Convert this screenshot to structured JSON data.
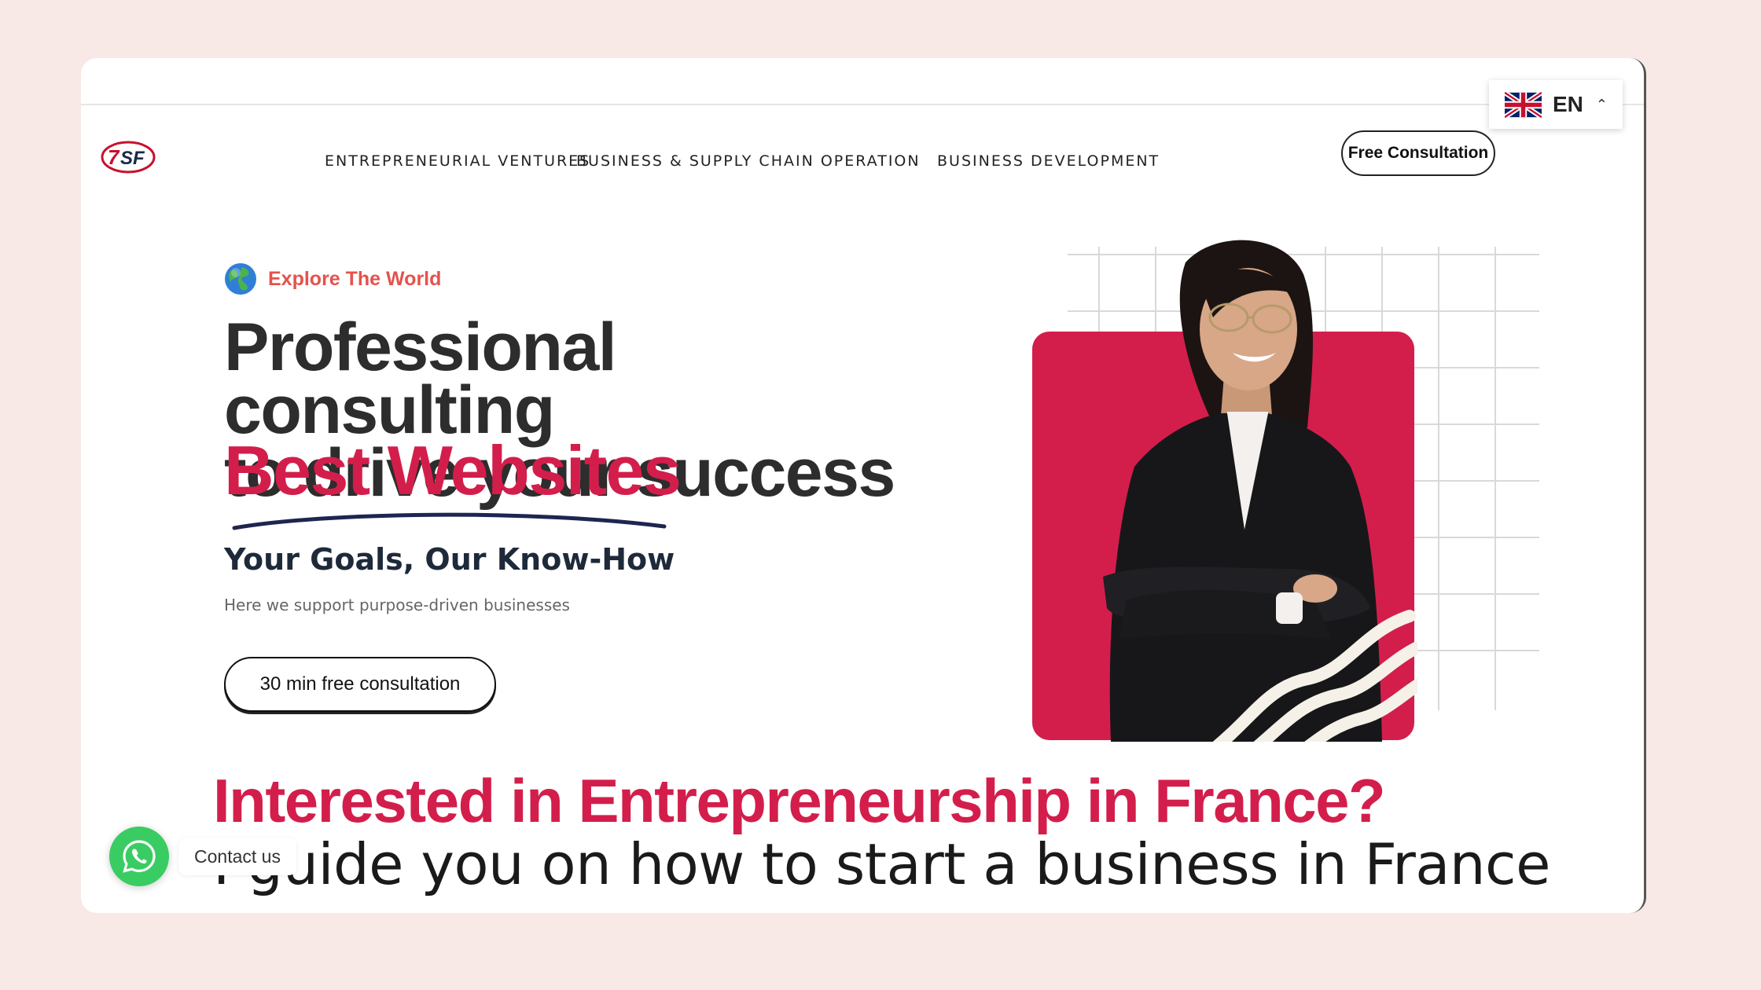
{
  "language": {
    "code": "EN",
    "flag": "uk-flag-icon"
  },
  "header": {
    "logo_text": "7SF",
    "nav": [
      "ENTREPRENEURIAL VENTURES",
      "BUSINESS & SUPPLY CHAIN OPERATION",
      "BUSINESS DEVELOPMENT"
    ],
    "cta": "Free Consultation"
  },
  "hero": {
    "eyebrow": "Explore The World",
    "title_line1": "Professional consulting",
    "title_line2": "to drive your success",
    "title_accent": "Best Websites",
    "subtitle": "Your Goals, Our Know-How",
    "description": "Here we support purpose-driven businesses",
    "button": "30 min free consultation"
  },
  "section": {
    "heading": "Interested in Entrepreneurship in France?",
    "subheading": "I guide you on how to start a business in France"
  },
  "chat": {
    "label": "Contact us",
    "icon": "whatsapp-icon"
  },
  "colors": {
    "accent": "#d31e4c",
    "eyebrow": "#e5524d",
    "background": "#f8e9e6",
    "whatsapp": "#39cc62"
  }
}
